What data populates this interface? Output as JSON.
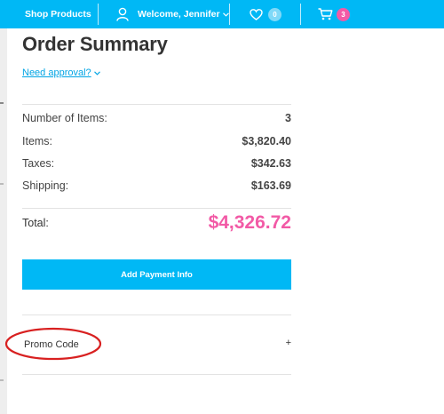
{
  "topbar": {
    "shop_label": "Shop Products",
    "welcome_label": "Welcome, Jennifer",
    "wishlist_count": "0",
    "cart_count": "3",
    "accent_color": "#00b8f5",
    "badge_color": "#f25aa6"
  },
  "summary": {
    "title": "Order Summary",
    "approval_link": "Need approval?",
    "rows": [
      {
        "label": "Number of Items:",
        "value": "3"
      },
      {
        "label": "Items:",
        "value": "$3,820.40"
      },
      {
        "label": "Taxes:",
        "value": "$342.63"
      },
      {
        "label": "Shipping:",
        "value": "$163.69"
      }
    ],
    "total_label": "Total:",
    "total_value": "$4,326.72",
    "pay_button": "Add Payment Info",
    "promo_label": "Promo Code",
    "promo_toggle": "+"
  },
  "icons": [
    "user-icon",
    "chevron-down-icon",
    "heart-icon",
    "cart-icon",
    "plus-icon"
  ]
}
